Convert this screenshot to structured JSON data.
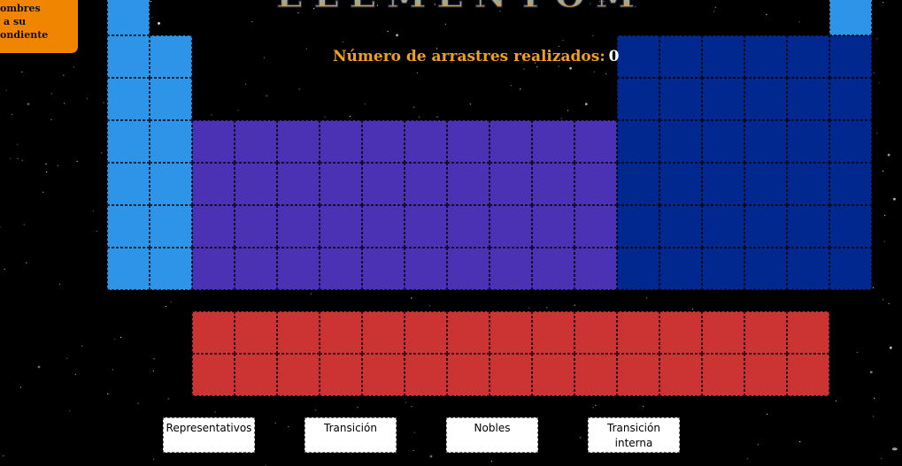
{
  "instructions": {
    "lines": [
      "ombres",
      "a su",
      "ondiente"
    ]
  },
  "header": {
    "title_logo": "ELEMENTOM"
  },
  "counter": {
    "label": "Número de arrastres realizados:",
    "value": "0"
  },
  "board": {
    "groups": [
      {
        "key": "rep",
        "name": "Representativos",
        "color": "#2e94e8"
      },
      {
        "key": "tra",
        "name": "Transición",
        "color": "#4b32b4"
      },
      {
        "key": "nob",
        "name": "Nobles",
        "color": "#00288e"
      },
      {
        "key": "int",
        "name": "Transición interna",
        "color": "#cc3333"
      }
    ]
  },
  "dropzones": [
    {
      "label": "Representativos"
    },
    {
      "label": "Transición"
    },
    {
      "label": "Nobles"
    },
    {
      "label": "Transición interna"
    }
  ]
}
